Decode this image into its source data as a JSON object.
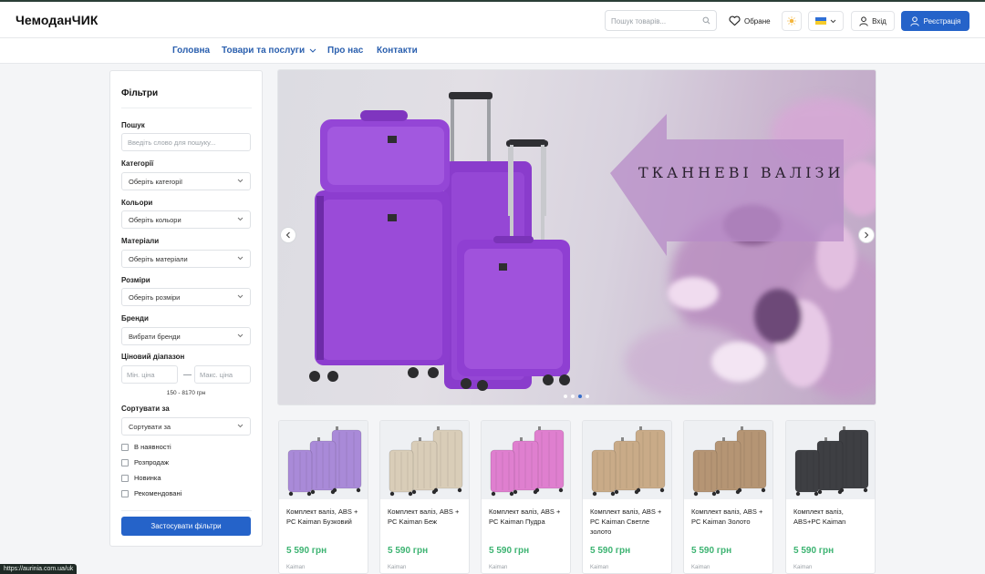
{
  "header": {
    "logo": "ЧемоданЧИК",
    "search_placeholder": "Пошук товарів...",
    "favorites_label": "Обране",
    "login_label": "Вхід",
    "register_label": "Реєстрація"
  },
  "nav": {
    "items": [
      {
        "label": "Головна"
      },
      {
        "label": "Товари та послуги"
      },
      {
        "label": "Про нас"
      },
      {
        "label": "Контакти"
      }
    ]
  },
  "filters": {
    "title": "Фільтри",
    "search_label": "Пошук",
    "search_placeholder": "Введіть слово для пошуку...",
    "category_label": "Категорії",
    "category_value": "Оберіть категорії",
    "colors_label": "Кольори",
    "colors_value": "Оберіть кольори",
    "materials_label": "Матеріали",
    "materials_value": "Оберіть матеріали",
    "sizes_label": "Розміри",
    "sizes_value": "Оберіть розміри",
    "brands_label": "Бренди",
    "brands_value": "Вибрати бренди",
    "price_label": "Ціновий діапазон",
    "price_min_placeholder": "Мін. ціна",
    "price_max_placeholder": "Макс. ціна",
    "price_range": "150 - 8170 грн",
    "sort_label": "Сортувати за",
    "sort_value": "Сортувати за",
    "checkboxes": [
      {
        "label": "В наявності"
      },
      {
        "label": "Розпродаж"
      },
      {
        "label": "Новинка"
      },
      {
        "label": "Рекомендовані"
      }
    ],
    "apply_label": "Застосувати фільтри"
  },
  "banner": {
    "title": "ТКАННЕВІ ВАЛІЗИ",
    "slides": 4,
    "active_slide": 3
  },
  "products": [
    {
      "name": "Комплект валіз, ABS + PC Kaiman Бузковий",
      "price": "5 590 грн",
      "brand": "Kaiman",
      "color": "#a98ad8"
    },
    {
      "name": "Комплект валіз, ABS + PC Kaiman Беж",
      "price": "5 590 грн",
      "brand": "Kaiman",
      "color": "#d9cdb8"
    },
    {
      "name": "Комплект валіз, ABS + PC Kaiman Пудра",
      "price": "5 590 грн",
      "brand": "Kaiman",
      "color": "#df7fcf"
    },
    {
      "name": "Комплект валіз, ABS + PC Kaiman Светле золото",
      "price": "5 590 грн",
      "brand": "Kaiman",
      "color": "#c9ab88"
    },
    {
      "name": "Комплект валіз, ABS + PC Kaiman Золото",
      "price": "5 590 грн",
      "brand": "Kaiman",
      "color": "#b59574"
    },
    {
      "name": "Комплект валіз, ABS+PC Kaiman",
      "price": "5 590 грн",
      "brand": "Kaiman",
      "color": "#3e3f43"
    }
  ],
  "status_url": "https://aurinia.com.ua/uk",
  "colors": {
    "accent": "#2563c9",
    "price": "#3cb371",
    "suitcase": "#8e3fcf"
  }
}
